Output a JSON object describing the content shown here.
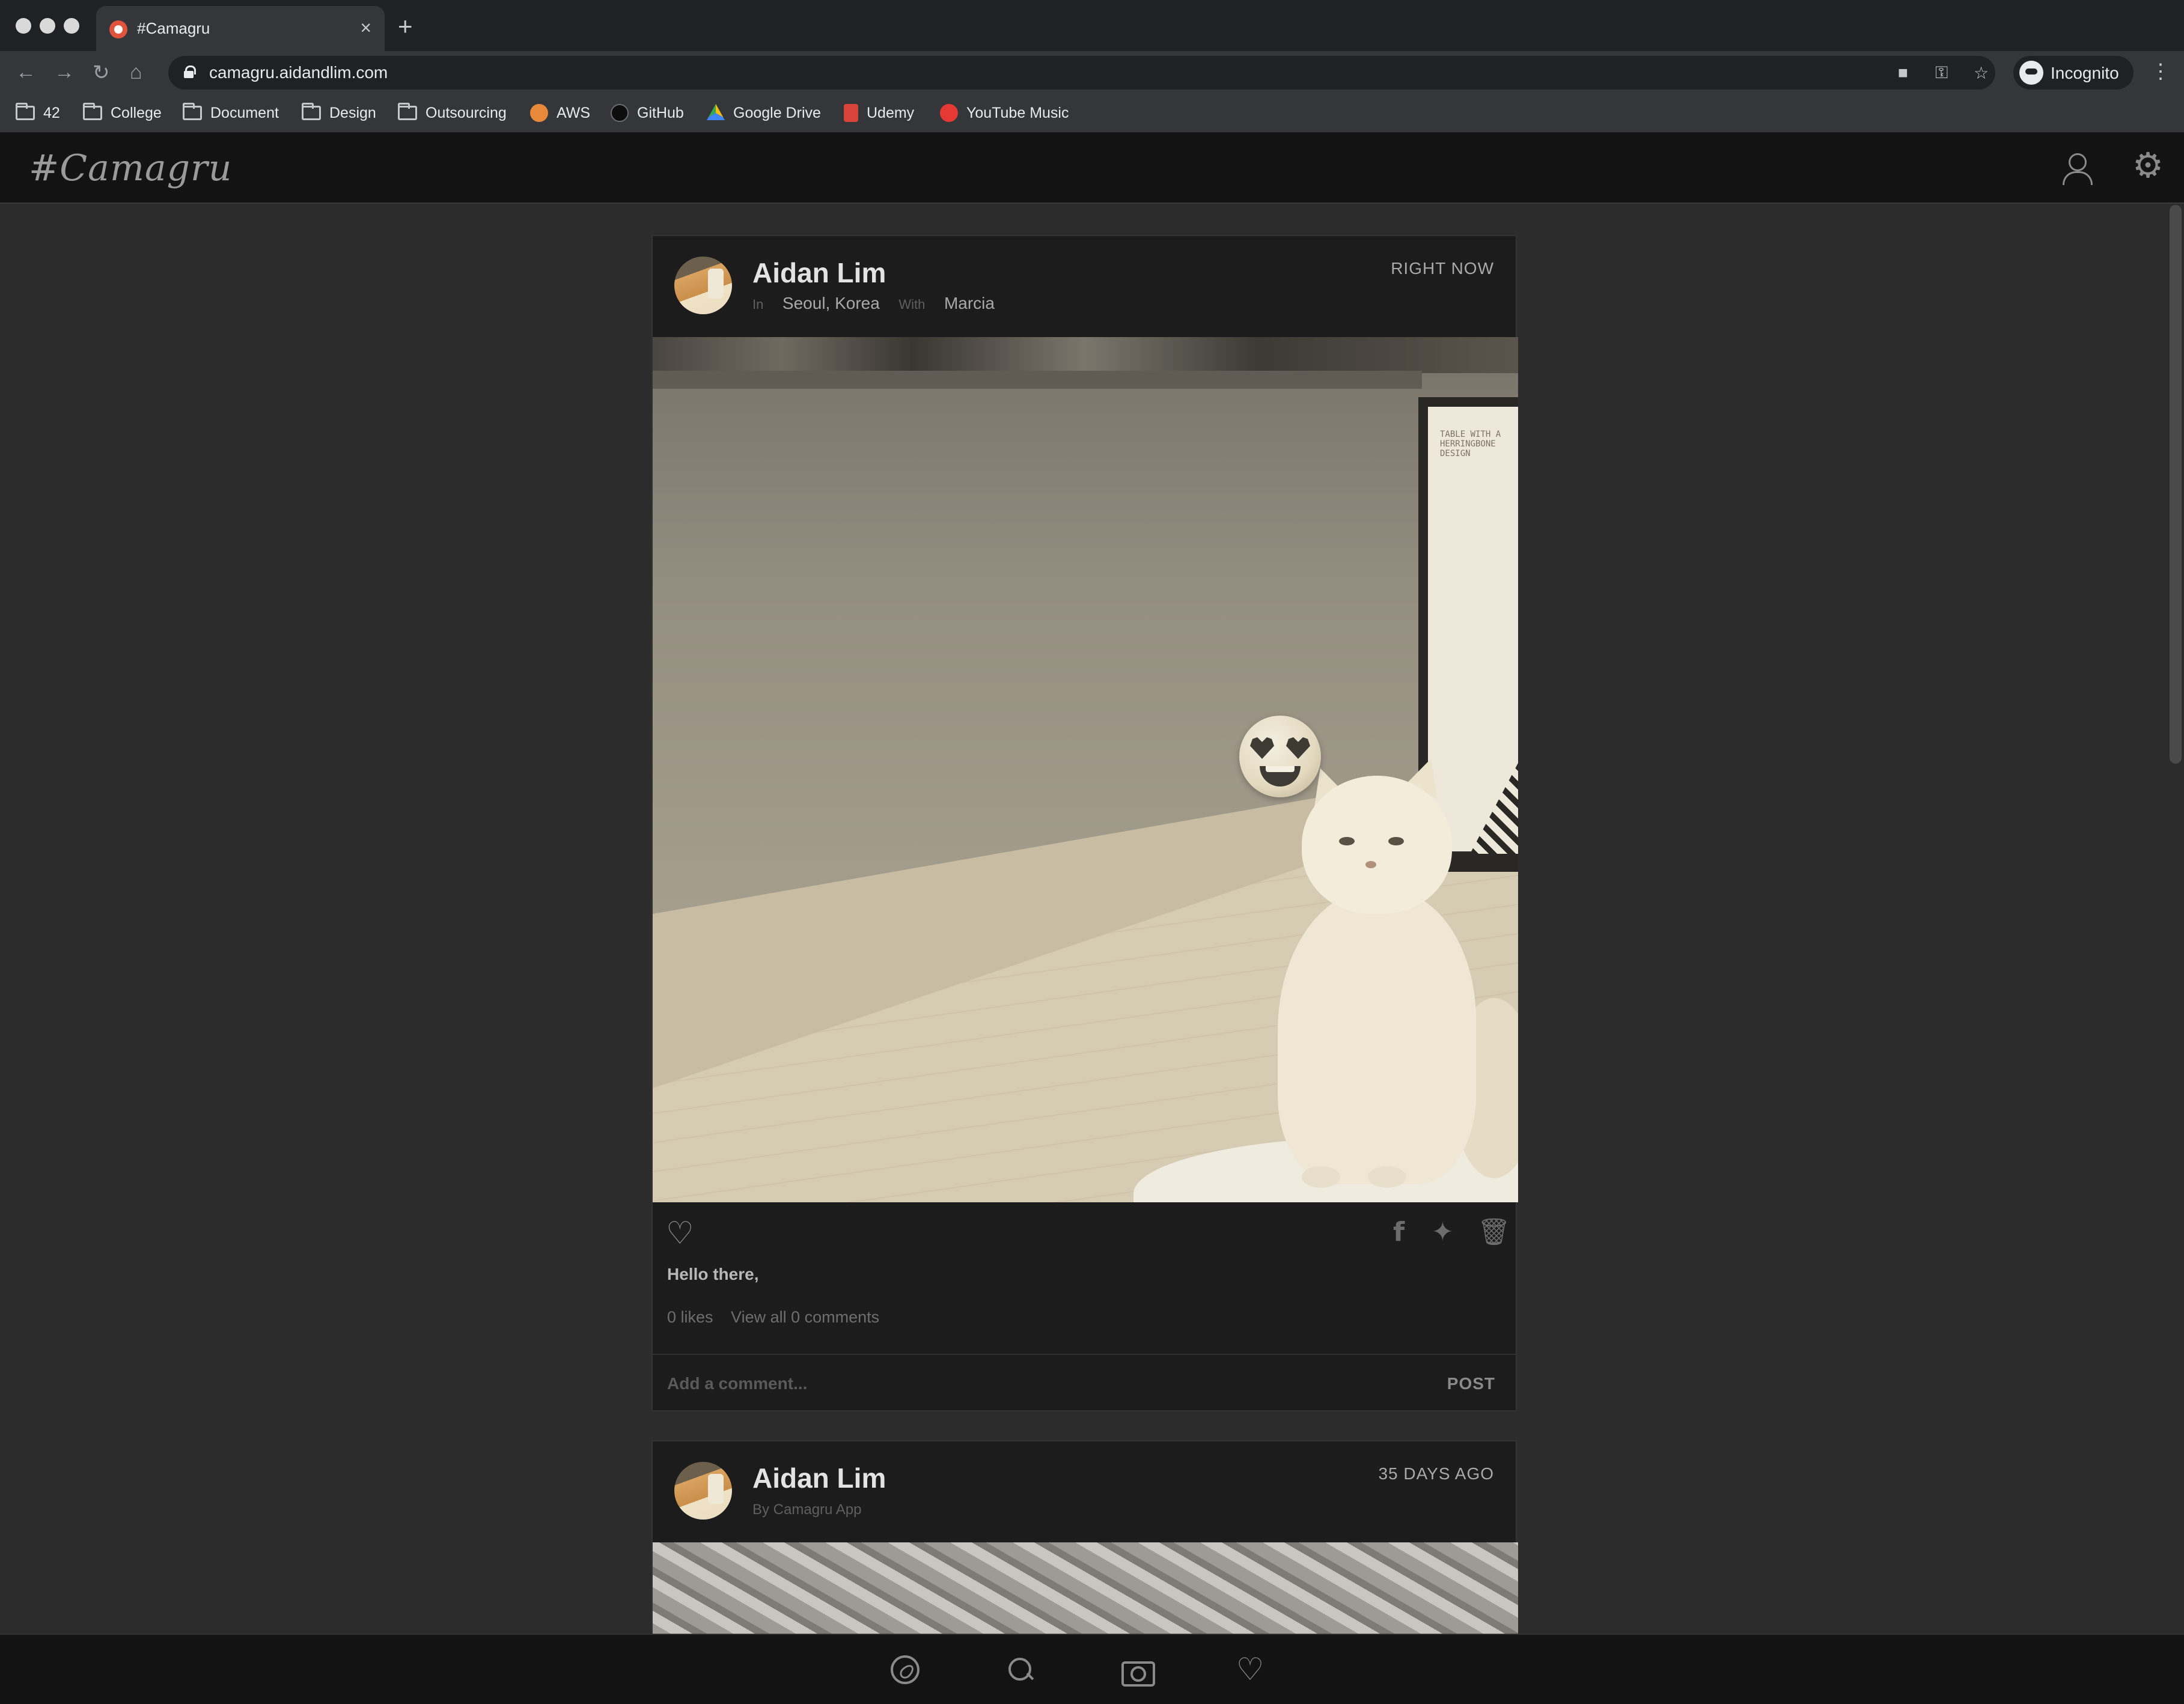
{
  "browser": {
    "tab_title": "#Camagru",
    "tab_close": "×",
    "new_tab": "+",
    "url": "camagru.aidandlim.com",
    "profile_label": "Incognito",
    "bookmarks": [
      {
        "label": "42",
        "icon": "folder-icon"
      },
      {
        "label": "College",
        "icon": "folder-icon"
      },
      {
        "label": "Document",
        "icon": "folder-icon"
      },
      {
        "label": "Design",
        "icon": "folder-icon"
      },
      {
        "label": "Outsourcing",
        "icon": "folder-icon"
      },
      {
        "label": "AWS",
        "icon": "aws-icon",
        "color": "#e8883a"
      },
      {
        "label": "GitHub",
        "icon": "github-icon",
        "color": "#1a1a1a"
      },
      {
        "label": "Google Drive",
        "icon": "google-drive-icon",
        "color": "#4caf50"
      },
      {
        "label": "Udemy",
        "icon": "udemy-icon",
        "color": "#d9443a"
      },
      {
        "label": "YouTube Music",
        "icon": "youtube-music-icon",
        "color": "#e53935"
      }
    ]
  },
  "app": {
    "logo": "#Camagru",
    "header_icons": [
      "user-icon",
      "gear-icon"
    ],
    "bottom_nav": [
      "compass-icon",
      "search-icon",
      "camera-icon",
      "heart-icon"
    ]
  },
  "posts": [
    {
      "author": "Aidan Lim",
      "in_label": "In",
      "location": "Seoul, Korea",
      "with_label": "With",
      "with": "Marcia",
      "timestamp": "RIGHT NOW",
      "poster_text": "TABLE WITH A HERRINGBONE DESIGN",
      "caption": "Hello there,",
      "likes": "0 likes",
      "comments_link": "View all 0 comments",
      "comment_placeholder": "Add a comment...",
      "post_button": "POST"
    },
    {
      "author": "Aidan Lim",
      "by": "By Camagru App",
      "timestamp": "35 DAYS AGO"
    }
  ],
  "colors": {
    "app_background": "#2c2c2c",
    "card_background": "#1c1c1c",
    "header_background": "#131313",
    "icon_gray": "#8a8a8a"
  }
}
